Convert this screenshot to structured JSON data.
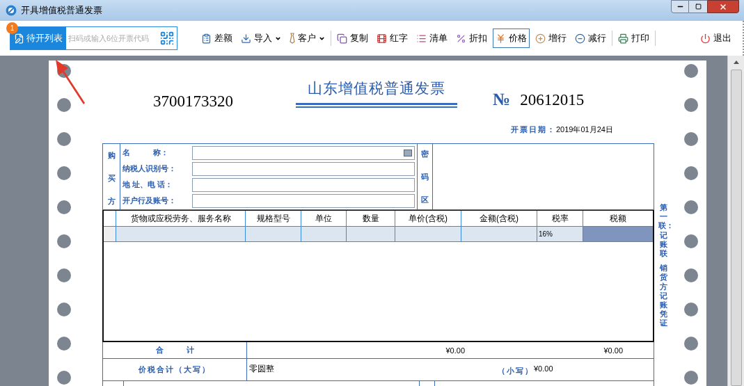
{
  "window": {
    "title": "开具增值税普通发票"
  },
  "toolbar": {
    "pending_button": {
      "label": "待开列表",
      "badge": "1"
    },
    "scan_field": {
      "placeholder": "扫码或输入6位开票代码"
    },
    "tools": [
      {
        "label": "差额",
        "dropdown": false,
        "selected": false,
        "separator_after": false
      },
      {
        "label": "导入",
        "dropdown": true,
        "selected": false,
        "separator_after": false
      },
      {
        "label": "客户",
        "dropdown": true,
        "selected": false,
        "separator_after": true
      },
      {
        "label": "复制",
        "dropdown": false,
        "selected": false,
        "separator_after": false
      },
      {
        "label": "红字",
        "dropdown": false,
        "selected": false,
        "separator_after": false
      },
      {
        "label": "清单",
        "dropdown": false,
        "selected": false,
        "separator_after": false
      },
      {
        "label": "折扣",
        "dropdown": false,
        "selected": false,
        "separator_after": false
      },
      {
        "label": "价格",
        "dropdown": false,
        "selected": true,
        "separator_after": false
      },
      {
        "label": "增行",
        "dropdown": false,
        "selected": false,
        "separator_after": false
      },
      {
        "label": "减行",
        "dropdown": false,
        "selected": false,
        "separator_after": true
      },
      {
        "label": "打印",
        "dropdown": false,
        "selected": false,
        "separator_after": true
      },
      {
        "label": "退出",
        "dropdown": false,
        "selected": false,
        "separator_after": false
      }
    ]
  },
  "invoice": {
    "tax_code": "3700173320",
    "title": "山东增值税普通发票",
    "number_sign": "№",
    "number": "20612015",
    "date_label": "开票日期：",
    "date": "2019年01月24日",
    "buyer": {
      "side_label": "购买方",
      "fields": [
        {
          "label": "名　　　称："
        },
        {
          "label": "纳税人识别号："
        },
        {
          "label": "地 址、电 话："
        },
        {
          "label": "开户行及账号："
        }
      ]
    },
    "cipher_label": "密码区",
    "table": {
      "columns": [
        "货物或应税劳务、服务名称",
        "规格型号",
        "单位",
        "数量",
        "单价(含税)",
        "金额(含税)",
        "税率",
        "税额"
      ],
      "rows": [
        {
          "cells": [
            {
              "selected": false
            },
            {
              "selected": false
            },
            {
              "selected": false
            },
            {
              "selected": false
            },
            {
              "selected": false
            },
            {
              "selected": false
            },
            {
              "text": "16%",
              "selected": false
            },
            {
              "selected": true
            }
          ]
        }
      ]
    },
    "copy_note": [
      "第一联：记账联",
      "销货方记账凭证"
    ],
    "totals": {
      "label": "合　　　计",
      "amount": "¥0.00",
      "tax": "¥0.00"
    },
    "grand_total": {
      "label": "价税合计（大写）",
      "words": "零圆整",
      "small_label": "（小写）",
      "small_value": "¥0.00"
    }
  }
}
